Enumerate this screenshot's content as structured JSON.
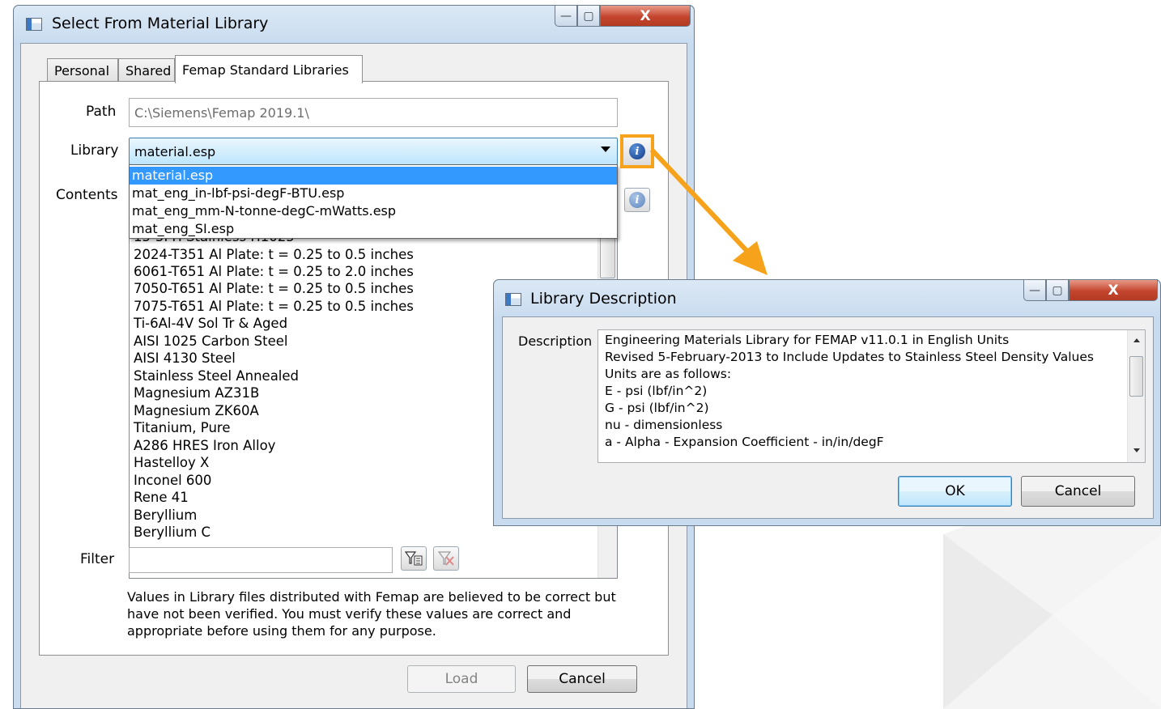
{
  "main_dialog": {
    "title": "Select From Material Library",
    "window_buttons": {
      "minimize": "—",
      "maximize": "▢",
      "close": "X"
    },
    "tabs": [
      {
        "label": "Personal",
        "active": false
      },
      {
        "label": "Shared",
        "active": false
      },
      {
        "label": "Femap Standard Libraries",
        "active": true
      }
    ],
    "path_label": "Path",
    "path_value": "C:\\Siemens\\Femap 2019.1\\",
    "library_label": "Library",
    "library_value": "material.esp",
    "library_options": [
      "material.esp",
      "mat_eng_in-lbf-psi-degF-BTU.esp",
      "mat_eng_mm-N-tonne-degC-mWatts.esp",
      "mat_eng_SI.esp"
    ],
    "contents_label": "Contents",
    "contents_items": [
      "15-5PH Stainless H1025",
      "2024-T351 Al Plate: t = 0.25 to 0.5 inches",
      "6061-T651 Al Plate: t = 0.25 to 2.0 inches",
      "7050-T651 Al Plate: t = 0.25 to 0.5 inches",
      "7075-T651 Al Plate: t = 0.25 to 0.5 inches",
      "Ti-6Al-4V Sol Tr & Aged",
      "AISI 1025 Carbon Steel",
      "AISI 4130 Steel",
      "Stainless Steel Annealed",
      "Magnesium AZ31B",
      "Magnesium ZK60A",
      "Titanium, Pure",
      "A286 HRES Iron Alloy",
      "Hastelloy X",
      "Inconel 600",
      "Rene 41",
      "Beryllium",
      "Beryllium C"
    ],
    "filter_label": "Filter",
    "filter_value": "",
    "note": [
      "Values in Library files distributed with Femap are believed to be correct but",
      "have not been verified. You must verify these values are correct and",
      "appropriate before using them for any purpose."
    ],
    "load_label": "Load",
    "cancel_label": "Cancel"
  },
  "description_dialog": {
    "title": "Library Description",
    "window_buttons": {
      "minimize": "—",
      "maximize": "▢",
      "close": "X"
    },
    "description_label": "Description",
    "lines": [
      "Engineering Materials Library for FEMAP v11.0.1 in English Units",
      "Revised 5-February-2013 to Include Updates to Stainless Steel Density Values",
      "Units are as follows:",
      "E - psi (lbf/in^2)",
      "G - psi (lbf/in^2)",
      "nu - dimensionless",
      "a - Alpha - Expansion Coefficient - in/in/degF"
    ],
    "ok_label": "OK",
    "cancel_label": "Cancel"
  },
  "colors": {
    "callout": "#f7a21b",
    "selection": "#3399ff"
  }
}
